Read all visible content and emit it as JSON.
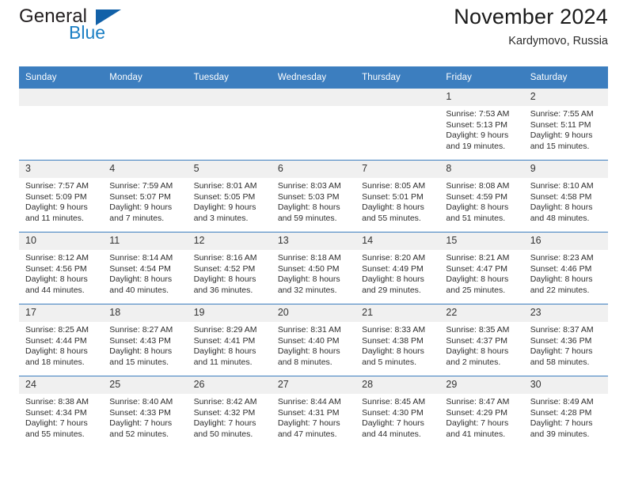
{
  "brand": {
    "name_part1": "General",
    "name_part2": "Blue",
    "logo_icon": "triangle-flag-icon"
  },
  "header": {
    "title": "November 2024",
    "subtitle": "Kardymovo, Russia"
  },
  "colors": {
    "header_blue": "#3c7ebf",
    "brand_blue": "#1b7fc4",
    "daynum_bg": "#f0f0f0"
  },
  "calendar": {
    "weekday_headers": [
      "Sunday",
      "Monday",
      "Tuesday",
      "Wednesday",
      "Thursday",
      "Friday",
      "Saturday"
    ],
    "weeks": [
      [
        {
          "day": "",
          "empty": true
        },
        {
          "day": "",
          "empty": true
        },
        {
          "day": "",
          "empty": true
        },
        {
          "day": "",
          "empty": true
        },
        {
          "day": "",
          "empty": true
        },
        {
          "day": "1",
          "sunrise": "Sunrise: 7:53 AM",
          "sunset": "Sunset: 5:13 PM",
          "daylight_line1": "Daylight: 9 hours",
          "daylight_line2": "and 19 minutes."
        },
        {
          "day": "2",
          "sunrise": "Sunrise: 7:55 AM",
          "sunset": "Sunset: 5:11 PM",
          "daylight_line1": "Daylight: 9 hours",
          "daylight_line2": "and 15 minutes."
        }
      ],
      [
        {
          "day": "3",
          "sunrise": "Sunrise: 7:57 AM",
          "sunset": "Sunset: 5:09 PM",
          "daylight_line1": "Daylight: 9 hours",
          "daylight_line2": "and 11 minutes."
        },
        {
          "day": "4",
          "sunrise": "Sunrise: 7:59 AM",
          "sunset": "Sunset: 5:07 PM",
          "daylight_line1": "Daylight: 9 hours",
          "daylight_line2": "and 7 minutes."
        },
        {
          "day": "5",
          "sunrise": "Sunrise: 8:01 AM",
          "sunset": "Sunset: 5:05 PM",
          "daylight_line1": "Daylight: 9 hours",
          "daylight_line2": "and 3 minutes."
        },
        {
          "day": "6",
          "sunrise": "Sunrise: 8:03 AM",
          "sunset": "Sunset: 5:03 PM",
          "daylight_line1": "Daylight: 8 hours",
          "daylight_line2": "and 59 minutes."
        },
        {
          "day": "7",
          "sunrise": "Sunrise: 8:05 AM",
          "sunset": "Sunset: 5:01 PM",
          "daylight_line1": "Daylight: 8 hours",
          "daylight_line2": "and 55 minutes."
        },
        {
          "day": "8",
          "sunrise": "Sunrise: 8:08 AM",
          "sunset": "Sunset: 4:59 PM",
          "daylight_line1": "Daylight: 8 hours",
          "daylight_line2": "and 51 minutes."
        },
        {
          "day": "9",
          "sunrise": "Sunrise: 8:10 AM",
          "sunset": "Sunset: 4:58 PM",
          "daylight_line1": "Daylight: 8 hours",
          "daylight_line2": "and 48 minutes."
        }
      ],
      [
        {
          "day": "10",
          "sunrise": "Sunrise: 8:12 AM",
          "sunset": "Sunset: 4:56 PM",
          "daylight_line1": "Daylight: 8 hours",
          "daylight_line2": "and 44 minutes."
        },
        {
          "day": "11",
          "sunrise": "Sunrise: 8:14 AM",
          "sunset": "Sunset: 4:54 PM",
          "daylight_line1": "Daylight: 8 hours",
          "daylight_line2": "and 40 minutes."
        },
        {
          "day": "12",
          "sunrise": "Sunrise: 8:16 AM",
          "sunset": "Sunset: 4:52 PM",
          "daylight_line1": "Daylight: 8 hours",
          "daylight_line2": "and 36 minutes."
        },
        {
          "day": "13",
          "sunrise": "Sunrise: 8:18 AM",
          "sunset": "Sunset: 4:50 PM",
          "daylight_line1": "Daylight: 8 hours",
          "daylight_line2": "and 32 minutes."
        },
        {
          "day": "14",
          "sunrise": "Sunrise: 8:20 AM",
          "sunset": "Sunset: 4:49 PM",
          "daylight_line1": "Daylight: 8 hours",
          "daylight_line2": "and 29 minutes."
        },
        {
          "day": "15",
          "sunrise": "Sunrise: 8:21 AM",
          "sunset": "Sunset: 4:47 PM",
          "daylight_line1": "Daylight: 8 hours",
          "daylight_line2": "and 25 minutes."
        },
        {
          "day": "16",
          "sunrise": "Sunrise: 8:23 AM",
          "sunset": "Sunset: 4:46 PM",
          "daylight_line1": "Daylight: 8 hours",
          "daylight_line2": "and 22 minutes."
        }
      ],
      [
        {
          "day": "17",
          "sunrise": "Sunrise: 8:25 AM",
          "sunset": "Sunset: 4:44 PM",
          "daylight_line1": "Daylight: 8 hours",
          "daylight_line2": "and 18 minutes."
        },
        {
          "day": "18",
          "sunrise": "Sunrise: 8:27 AM",
          "sunset": "Sunset: 4:43 PM",
          "daylight_line1": "Daylight: 8 hours",
          "daylight_line2": "and 15 minutes."
        },
        {
          "day": "19",
          "sunrise": "Sunrise: 8:29 AM",
          "sunset": "Sunset: 4:41 PM",
          "daylight_line1": "Daylight: 8 hours",
          "daylight_line2": "and 11 minutes."
        },
        {
          "day": "20",
          "sunrise": "Sunrise: 8:31 AM",
          "sunset": "Sunset: 4:40 PM",
          "daylight_line1": "Daylight: 8 hours",
          "daylight_line2": "and 8 minutes."
        },
        {
          "day": "21",
          "sunrise": "Sunrise: 8:33 AM",
          "sunset": "Sunset: 4:38 PM",
          "daylight_line1": "Daylight: 8 hours",
          "daylight_line2": "and 5 minutes."
        },
        {
          "day": "22",
          "sunrise": "Sunrise: 8:35 AM",
          "sunset": "Sunset: 4:37 PM",
          "daylight_line1": "Daylight: 8 hours",
          "daylight_line2": "and 2 minutes."
        },
        {
          "day": "23",
          "sunrise": "Sunrise: 8:37 AM",
          "sunset": "Sunset: 4:36 PM",
          "daylight_line1": "Daylight: 7 hours",
          "daylight_line2": "and 58 minutes."
        }
      ],
      [
        {
          "day": "24",
          "sunrise": "Sunrise: 8:38 AM",
          "sunset": "Sunset: 4:34 PM",
          "daylight_line1": "Daylight: 7 hours",
          "daylight_line2": "and 55 minutes."
        },
        {
          "day": "25",
          "sunrise": "Sunrise: 8:40 AM",
          "sunset": "Sunset: 4:33 PM",
          "daylight_line1": "Daylight: 7 hours",
          "daylight_line2": "and 52 minutes."
        },
        {
          "day": "26",
          "sunrise": "Sunrise: 8:42 AM",
          "sunset": "Sunset: 4:32 PM",
          "daylight_line1": "Daylight: 7 hours",
          "daylight_line2": "and 50 minutes."
        },
        {
          "day": "27",
          "sunrise": "Sunrise: 8:44 AM",
          "sunset": "Sunset: 4:31 PM",
          "daylight_line1": "Daylight: 7 hours",
          "daylight_line2": "and 47 minutes."
        },
        {
          "day": "28",
          "sunrise": "Sunrise: 8:45 AM",
          "sunset": "Sunset: 4:30 PM",
          "daylight_line1": "Daylight: 7 hours",
          "daylight_line2": "and 44 minutes."
        },
        {
          "day": "29",
          "sunrise": "Sunrise: 8:47 AM",
          "sunset": "Sunset: 4:29 PM",
          "daylight_line1": "Daylight: 7 hours",
          "daylight_line2": "and 41 minutes."
        },
        {
          "day": "30",
          "sunrise": "Sunrise: 8:49 AM",
          "sunset": "Sunset: 4:28 PM",
          "daylight_line1": "Daylight: 7 hours",
          "daylight_line2": "and 39 minutes."
        }
      ]
    ]
  }
}
